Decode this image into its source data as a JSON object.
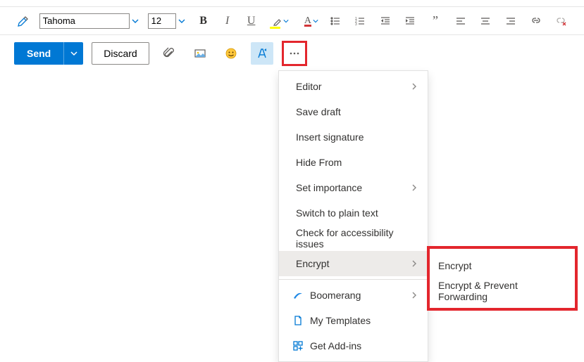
{
  "format_toolbar": {
    "font_name": "Tahoma",
    "font_size": "12"
  },
  "action_toolbar": {
    "send_label": "Send",
    "discard_label": "Discard"
  },
  "menu": {
    "items": [
      {
        "label": "Editor",
        "has_submenu": true
      },
      {
        "label": "Save draft"
      },
      {
        "label": "Insert signature"
      },
      {
        "label": "Hide From"
      },
      {
        "label": "Set importance",
        "has_submenu": true
      },
      {
        "label": "Switch to plain text"
      },
      {
        "label": "Check for accessibility issues"
      },
      {
        "label": "Encrypt",
        "has_submenu": true,
        "active": true
      }
    ],
    "items2": [
      {
        "label": "Boomerang",
        "icon": "boomerang",
        "has_submenu": true
      },
      {
        "label": "My Templates",
        "icon": "templates"
      },
      {
        "label": "Get Add-ins",
        "icon": "addins"
      }
    ]
  },
  "submenu": {
    "items": [
      {
        "label": "Encrypt"
      },
      {
        "label": "Encrypt & Prevent Forwarding"
      }
    ]
  },
  "colors": {
    "accent": "#0078d4",
    "toolbar_active_bg": "#cde6f7",
    "highlight_yellow": "#ffff00",
    "font_color_red": "#d13438",
    "annotation_red": "#e3262d"
  }
}
